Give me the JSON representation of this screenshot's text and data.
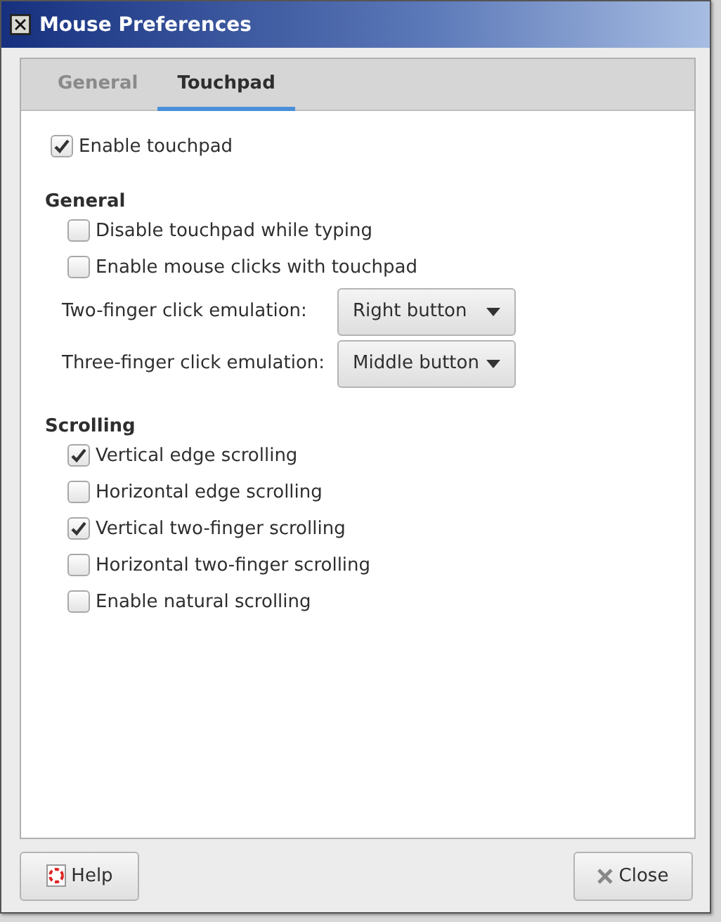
{
  "window": {
    "title": "Mouse Preferences"
  },
  "tabs": [
    {
      "label": "General",
      "selected": false
    },
    {
      "label": "Touchpad",
      "selected": true
    }
  ],
  "enable_touchpad": {
    "label": "Enable touchpad",
    "checked": true
  },
  "sections": [
    {
      "heading": "General",
      "items": [
        {
          "kind": "checkbox",
          "label": "Disable touchpad while typing",
          "checked": false
        },
        {
          "kind": "checkbox",
          "label": "Enable mouse clicks with touchpad",
          "checked": false
        },
        {
          "kind": "dropdown",
          "label": "Two-finger click emulation:",
          "value": "Right button"
        },
        {
          "kind": "dropdown",
          "label": "Three-finger click emulation:",
          "value": "Middle button"
        }
      ]
    },
    {
      "heading": "Scrolling",
      "items": [
        {
          "kind": "checkbox",
          "label": "Vertical edge scrolling",
          "checked": true
        },
        {
          "kind": "checkbox",
          "label": "Horizontal edge scrolling",
          "checked": false
        },
        {
          "kind": "checkbox",
          "label": "Vertical two-finger scrolling",
          "checked": true
        },
        {
          "kind": "checkbox",
          "label": "Horizontal two-finger scrolling",
          "checked": false
        },
        {
          "kind": "checkbox",
          "label": "Enable natural scrolling",
          "checked": false
        }
      ]
    }
  ],
  "buttons": [
    {
      "kind": "help",
      "label": "Help"
    },
    {
      "kind": "close",
      "label": "Close"
    }
  ]
}
